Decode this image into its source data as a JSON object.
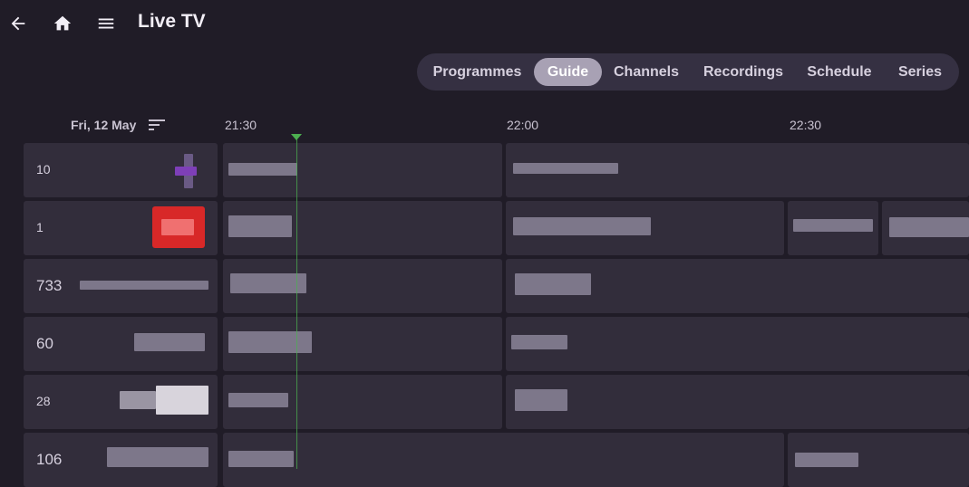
{
  "header": {
    "title": "Live TV",
    "icons": [
      "back-arrow-icon",
      "home-icon",
      "menu-icon"
    ]
  },
  "tabs": [
    {
      "label": "Programmes",
      "active": false
    },
    {
      "label": "Guide",
      "active": true
    },
    {
      "label": "Channels",
      "active": false
    },
    {
      "label": "Recordings",
      "active": false
    },
    {
      "label": "Schedule",
      "active": false
    },
    {
      "label": "Series",
      "active": false
    }
  ],
  "guide": {
    "date": "Fri, 12 May",
    "times": [
      "21:30",
      "22:00",
      "22:30"
    ],
    "channels": [
      {
        "number": "10"
      },
      {
        "number": "1"
      },
      {
        "number": "733"
      },
      {
        "number": "60"
      },
      {
        "number": "28"
      },
      {
        "number": "106"
      }
    ]
  },
  "colors": {
    "background": "#201c27",
    "cell": "#322d3b",
    "tabbar": "#353042",
    "active_tab": "#a8a1b4",
    "now_indicator": "#4caf50"
  }
}
